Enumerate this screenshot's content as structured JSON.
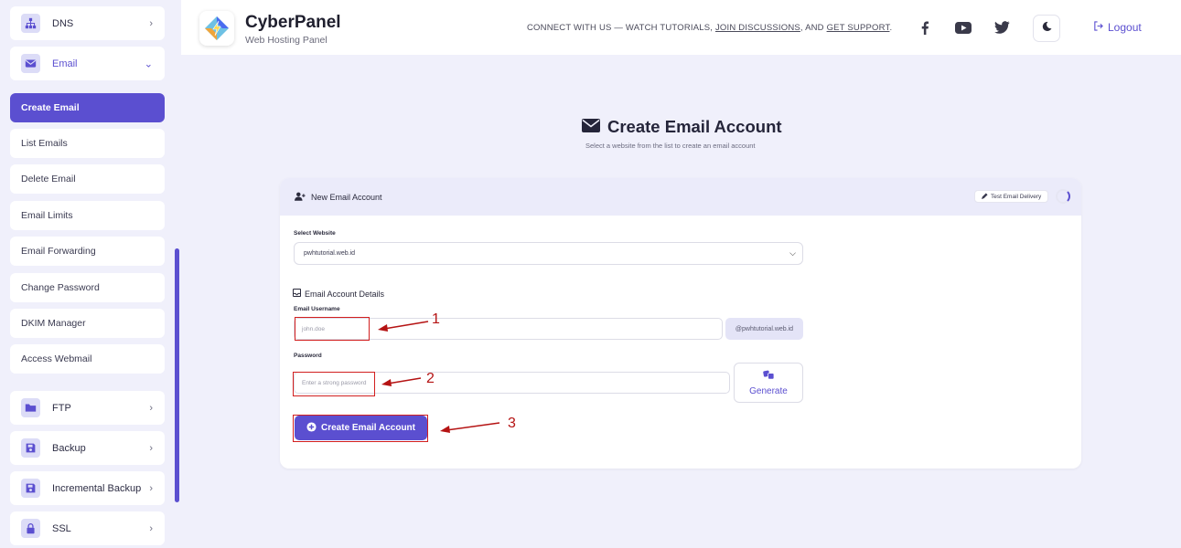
{
  "sidebar": {
    "dns": "DNS",
    "email": "Email",
    "email_items": [
      "Create Email",
      "List Emails",
      "Delete Email",
      "Email Limits",
      "Email Forwarding",
      "Change Password",
      "DKIM Manager",
      "Access Webmail"
    ],
    "ftp": "FTP",
    "backup": "Backup",
    "incremental_backup": "Incremental Backup",
    "ssl": "SSL"
  },
  "header": {
    "brand": "CyberPanel",
    "brand_sub": "Web Hosting Panel",
    "connect_prefix": "CONNECT WITH US — WATCH TUTORIALS, ",
    "connect_link1": "JOIN DISCUSSIONS",
    "connect_mid": ", AND ",
    "connect_link2": "GET SUPPORT",
    "connect_suffix": ".",
    "logout": "Logout"
  },
  "page": {
    "title": "Create Email Account",
    "subtitle": "Select a website from the list to create an email account"
  },
  "card": {
    "title": "New Email Account",
    "test_delivery": "Test Email Delivery",
    "select_website_label": "Select Website",
    "selected_website": "pwhtutorial.web.id",
    "details_title": "Email Account Details",
    "username_label": "Email Username",
    "username_placeholder": "john.doe",
    "domain_suffix": "@pwhtutorial.web.id",
    "password_label": "Password",
    "password_placeholder": "Enter a strong password",
    "generate": "Generate",
    "create_button": "Create Email Account"
  },
  "annotations": [
    "1",
    "2",
    "3"
  ],
  "colors": {
    "accent": "#5b4fd0",
    "annotation": "#d21f1f",
    "background": "#f0f0fb"
  }
}
